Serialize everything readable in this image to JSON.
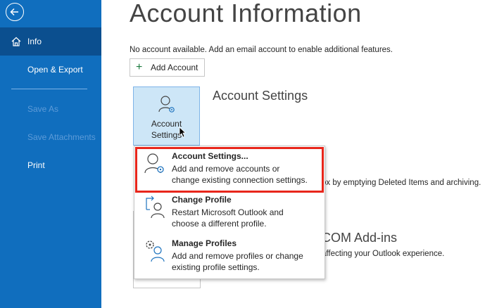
{
  "sidebar": {
    "items": [
      {
        "label": "Info"
      },
      {
        "label": "Open & Export"
      },
      {
        "label": "Save As"
      },
      {
        "label": "Save Attachments"
      },
      {
        "label": "Print"
      }
    ]
  },
  "main": {
    "title": "Account Information",
    "notice": "No account available. Add an email account to enable additional features.",
    "add_account_label": "Add Account",
    "account_settings_tile": {
      "line1": "Account",
      "line2": "Settings"
    },
    "account_settings_heading": "Account Settings",
    "background_text_1": "ox by emptying Deleted Items and archiving.",
    "background_heading_2": "COM Add-ins",
    "background_text_2": "affecting your Outlook experience."
  },
  "menu": {
    "items": [
      {
        "title": "Account Settings...",
        "desc1": "Add and remove accounts or",
        "desc2": "change existing connection settings.",
        "icon": "account-settings-icon"
      },
      {
        "title": "Change Profile",
        "desc1": "Restart Microsoft Outlook and",
        "desc2": "choose a different profile.",
        "icon": "change-profile-icon"
      },
      {
        "title": "Manage Profiles",
        "desc1": "Add and remove profiles or change",
        "desc2": "existing profile settings.",
        "icon": "manage-profiles-icon"
      }
    ]
  },
  "colors": {
    "sidebar": "#106ebe",
    "sidebar_active": "#0b4f8f",
    "highlight": "#e8261b",
    "tile": "#cde6f7"
  }
}
